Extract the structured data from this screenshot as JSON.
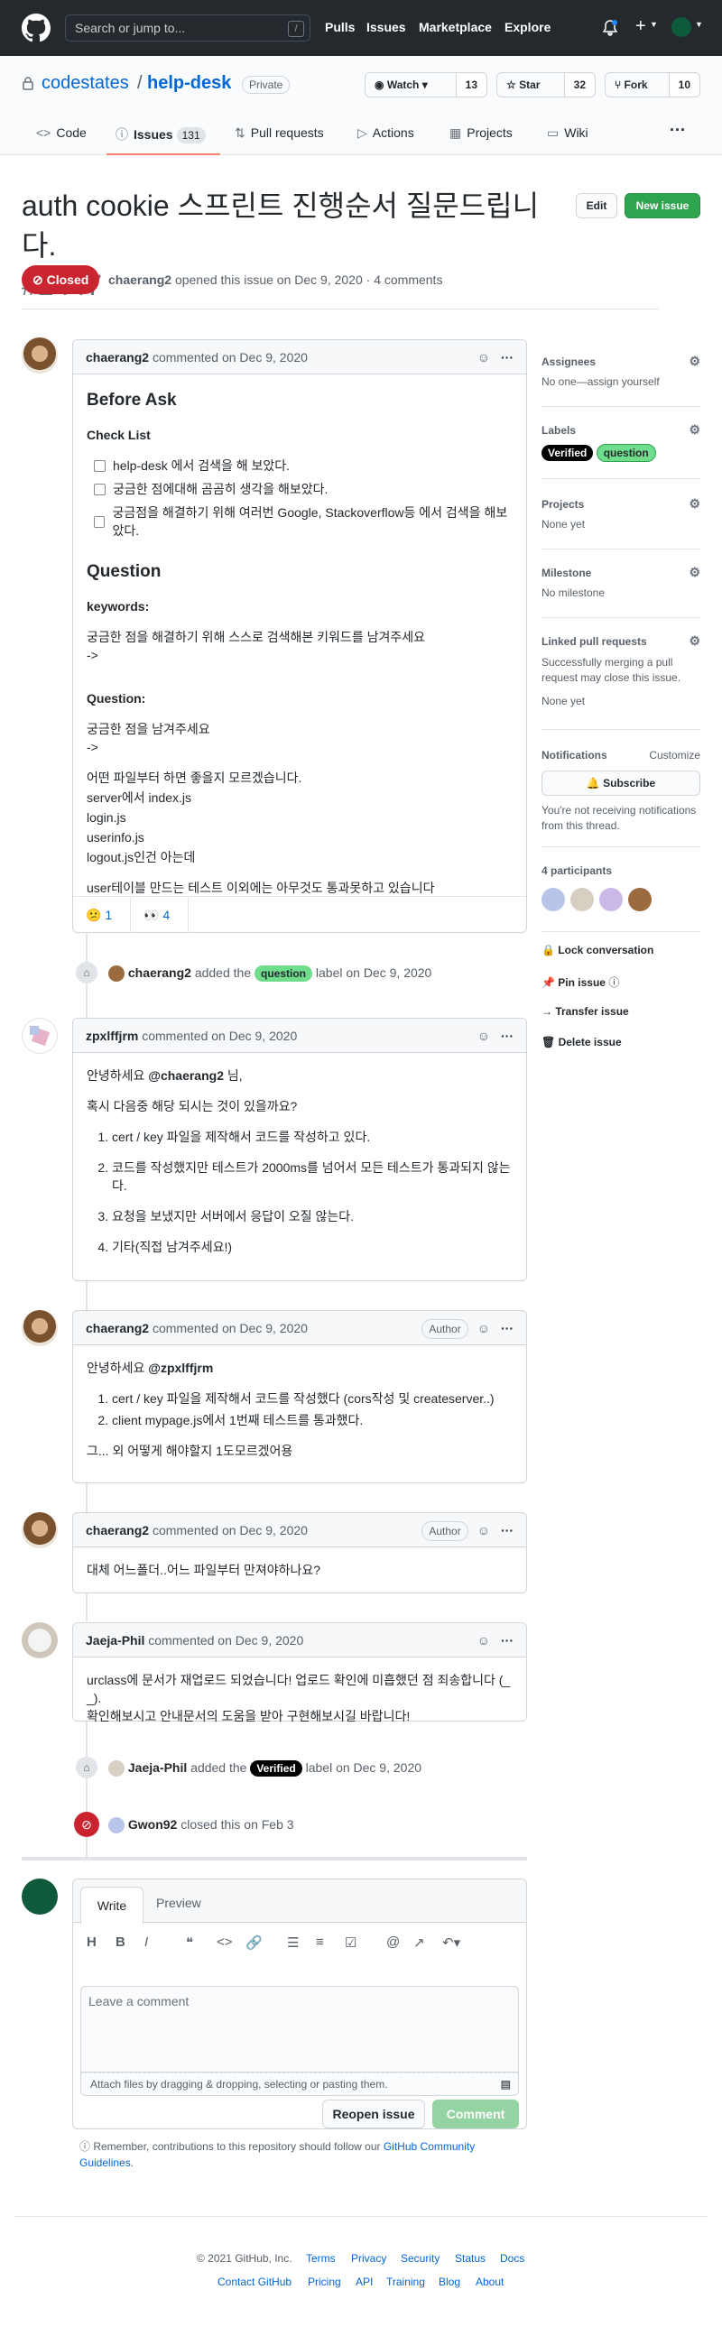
{
  "header": {
    "search_placeholder": "Search or jump to...",
    "search_shortcut": "/",
    "nav": [
      "Pulls",
      "Issues",
      "Marketplace",
      "Explore"
    ]
  },
  "repo": {
    "owner": "codestates",
    "name": "help-desk",
    "visibility": "Private",
    "watch_label": "Watch",
    "watch_count": "13",
    "star_label": "Star",
    "star_count": "32",
    "fork_label": "Fork",
    "fork_count": "10",
    "tabs": [
      "Code",
      "Issues",
      "Pull requests",
      "Actions",
      "Projects",
      "Wiki"
    ],
    "issues_count": "131"
  },
  "issue": {
    "title": "auth cookie 스프린트 진행순서 질문드립니다.",
    "number": "#2447",
    "edit_label": "Edit",
    "new_issue_label": "New issue",
    "state": "Closed",
    "author": "chaerang2",
    "meta_text": "opened this issue on Dec 9, 2020 · 4 comments"
  },
  "comment1": {
    "author": "chaerang2",
    "meta": "commented on Dec 9, 2020",
    "heading_before": "Before Ask",
    "checklist_title": "Check List",
    "checklist": [
      "help-desk 에서 검색을 해 보았다.",
      "궁금한 점에대해 곰곰히 생각을 해보았다.",
      "궁금점을 해결하기 위해 여러번 Google, Stackoverflow등 에서 검색을 해보았다."
    ],
    "heading_question": "Question",
    "keywords_label": "keywords:",
    "keywords_text": "궁금한 점을 해결하기 위해 스스로 검색해본 키워드를 남겨주세요",
    "arrow1": "->",
    "question_label": "Question:",
    "question_text": "궁금한 점을 남겨주세요",
    "arrow2": "->",
    "lines": [
      "어떤 파일부터 하면 좋을지 모르겠습니다.",
      "server에서 index.js",
      "login.js",
      "userinfo.js",
      "logout.js인건 아는데"
    ],
    "last_line": "user테이블 만드는 테스트 이외에는 아무것도 통과못하고 있습니다",
    "reaction1_emoji": "😕",
    "reaction1_count": "1",
    "reaction2_emoji": "👀",
    "reaction2_count": "4"
  },
  "event1": {
    "actor": "chaerang2",
    "text1": "added the",
    "label": "question",
    "text2": "label on Dec 9, 2020"
  },
  "comment2": {
    "author": "zpxlffjrm",
    "meta": "commented on Dec 9, 2020",
    "greeting_pre": "안녕하세요 ",
    "mention": "@chaerang2",
    "greeting_post": " 님,",
    "intro": "혹시 다음중 해당 되시는 것이 있을까요?",
    "items": [
      "cert / key 파일을 제작해서 코드를 작성하고 있다.",
      "코드를 작성했지만 테스트가 2000ms를 넘어서 모든 테스트가 통과되지 않는다.",
      "요청을 보냈지만 서버에서 응답이 오질 않는다.",
      "기타(직접 남겨주세요!)"
    ]
  },
  "comment3": {
    "author": "chaerang2",
    "meta": "commented on Dec 9, 2020",
    "badge": "Author",
    "greeting_pre": "안녕하세요 ",
    "mention": "@zpxlffjrm",
    "items": [
      "cert / key 파일을 제작해서 코드를 작성했다 (cors작성 및 createserver..)",
      "client mypage.js에서 1번째 테스트를 통과했다."
    ],
    "closing": "그... 외 어떻게 해야할지 1도모르겠어용"
  },
  "comment4": {
    "author": "chaerang2",
    "meta": "commented on Dec 9, 2020",
    "badge": "Author",
    "text": "대체 어느폴더..어느 파일부터 만져야하나요?"
  },
  "comment5": {
    "author": "Jaeja-Phil",
    "meta": "commented on Dec 9, 2020",
    "line1": "urclass에 문서가 재업로드 되었습니다! 업로드 확인에 미흡했던 점 죄송합니다 (_ _).",
    "line2": "확인해보시고 안내문서의 도움을 받아 구현해보시길 바랍니다!"
  },
  "event2": {
    "actor": "Jaeja-Phil",
    "text1": "added the",
    "label": "Verified",
    "text2": "label on Dec 9, 2020"
  },
  "event3": {
    "actor": "Gwon92",
    "text": "closed this on Feb 3"
  },
  "editor": {
    "tab_write": "Write",
    "tab_preview": "Preview",
    "placeholder": "Leave a comment",
    "attach_hint": "Attach files by dragging & dropping, selecting or pasting them.",
    "reopen_label": "Reopen issue",
    "comment_label": "Comment",
    "note_pre": "Remember, contributions to this repository should follow our ",
    "note_link": "GitHub Community Guidelines",
    "note_post": "."
  },
  "sidebar": {
    "assignees_title": "Assignees",
    "assignees_value": "No one—assign yourself",
    "labels_title": "Labels",
    "label_verified": "Verified",
    "label_question": "question",
    "projects_title": "Projects",
    "projects_value": "None yet",
    "milestone_title": "Milestone",
    "milestone_value": "No milestone",
    "linked_title": "Linked pull requests",
    "linked_desc": "Successfully merging a pull request may close this issue.",
    "linked_value": "None yet",
    "notifications_title": "Notifications",
    "customize": "Customize",
    "subscribe": "Subscribe",
    "notif_desc": "You're not receiving notifications from this thread.",
    "participants": "4 participants",
    "lock": "Lock conversation",
    "pin": "Pin issue",
    "transfer": "Transfer issue",
    "delete": "Delete issue"
  },
  "footer": {
    "copyright": "© 2021 GitHub, Inc.",
    "row1": [
      "Terms",
      "Privacy",
      "Security",
      "Status",
      "Docs"
    ],
    "row2": [
      "Contact GitHub",
      "Pricing",
      "API",
      "Training",
      "Blog",
      "About"
    ]
  },
  "colors": {
    "closed": "#cb2431",
    "green": "#2ea44f",
    "question_label": "#6fdd8b",
    "verified_label": "#000000"
  }
}
